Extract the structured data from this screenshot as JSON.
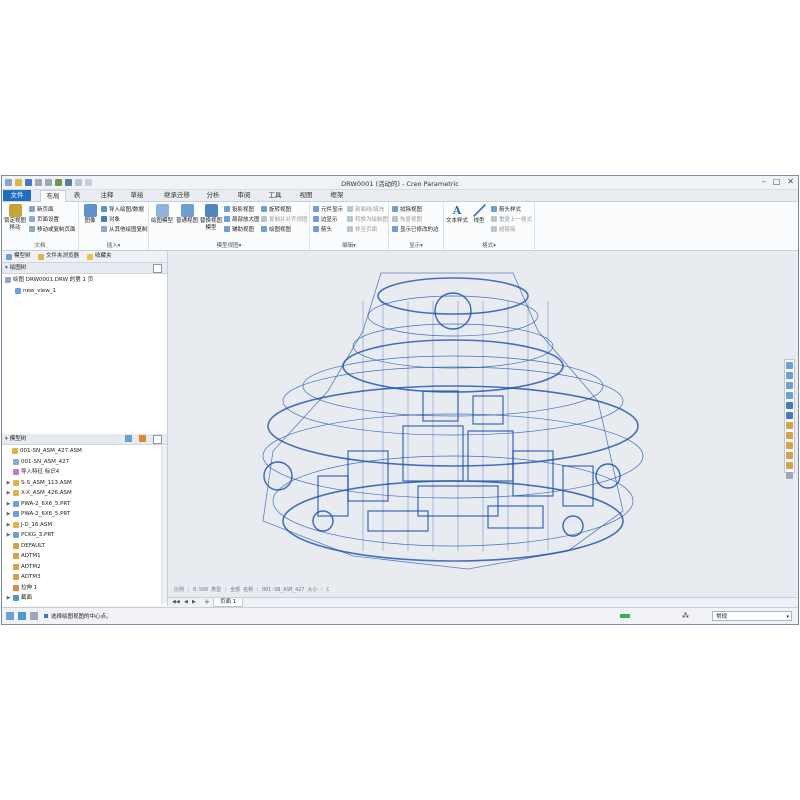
{
  "window": {
    "title": "DRW0001 (活动的) - Creo Parametric",
    "controls": {
      "minimize": "–",
      "maximize": "□",
      "close": "✕"
    }
  },
  "ribbon_tabs": [
    "文件",
    "布局",
    "表",
    "注释",
    "草绘",
    "继承迁移",
    "分析",
    "审阅",
    "工具",
    "视图",
    "框架"
  ],
  "ribbon": {
    "doc": {
      "label": "文档",
      "lock_view": "锁定视图\n移动",
      "new_page": "新页面",
      "page_setup": "页面设置",
      "move_copy_page": "移动或复制页面"
    },
    "insert": {
      "label": "插入▾",
      "image": "图像",
      "import_drawing": "导入绘图/数据",
      "object": "对象",
      "from_template": "从其他绘图复制"
    },
    "model_views": {
      "label": "模型视图▾",
      "drawing_model": "绘图模型",
      "normal_view": "普通视图",
      "replace_view": "替换视图\n模型",
      "projection_view": "投影视图",
      "detail_view": "局部放大图",
      "auxiliary_view": "辅助视图",
      "rotate_view": "旋转视图",
      "copy_align_view": "复制并对齐视图",
      "drawing_view": "绘图视图"
    },
    "edit": {
      "label": "编辑▾",
      "element_display": "元件显示",
      "edge_display": "边显示",
      "arrow": "箭头",
      "hatch_fill": "剖面线/填充",
      "convert_draft": "转换为绘制图",
      "move_to_page": "移至页面"
    },
    "display": {
      "label": "显示▾",
      "redraw": "拭除视图",
      "restore_view": "恢复视图",
      "show_modified": "显示已修改的边"
    },
    "format": {
      "label": "格式▾",
      "text_style": "文本样式",
      "line_style": "线型",
      "arrow_style": "箭头样式",
      "repeat_last": "重复上一格式",
      "hyperlink": "超链接"
    }
  },
  "left_panel": {
    "tabs": [
      "模型树",
      "文件夹浏览器",
      "收藏夹"
    ],
    "drawing_tree_title": "绘图树",
    "drawing_tree": [
      "绘图 DRW0001.DRW 的第 1 页",
      "new_view_1"
    ],
    "model_tree_title": "模型树",
    "model_tree": [
      {
        "label": "001-SN_ASM_427.ASM",
        "expand": "",
        "icon": "assembly-icon"
      },
      {
        "label": "001-SN_ASM_427",
        "expand": "",
        "icon": "datum-csys-icon"
      },
      {
        "label": "导入特征 标识4",
        "expand": "",
        "icon": "import-feature-icon"
      },
      {
        "label": "S-S_ASM_113.ASM",
        "expand": "▶",
        "icon": "assembly-icon"
      },
      {
        "label": "X-X_ASM_426.ASM",
        "expand": "▶",
        "icon": "assembly-icon"
      },
      {
        "label": "PWA-2_6X6_5.PRT",
        "expand": "▶",
        "icon": "part-icon"
      },
      {
        "label": "PWA-2_6X6_5.PRT",
        "expand": "▶",
        "icon": "part-icon"
      },
      {
        "label": "J-D_16.ASM",
        "expand": "▶",
        "icon": "assembly-icon"
      },
      {
        "label": "PCKG_3.PRT",
        "expand": "▶",
        "icon": "part-icon"
      },
      {
        "label": "DEFAULT",
        "expand": "",
        "icon": "csys-icon"
      },
      {
        "label": "ADTM1",
        "expand": "",
        "icon": "datum-plane-icon"
      },
      {
        "label": "ADTM2",
        "expand": "",
        "icon": "datum-plane-icon"
      },
      {
        "label": "ADTM3",
        "expand": "",
        "icon": "datum-plane-icon"
      },
      {
        "label": "拉伸 1",
        "expand": "",
        "icon": "extrude-icon"
      },
      {
        "label": "截面",
        "expand": "▶",
        "icon": "section-icon"
      }
    ]
  },
  "canvas": {
    "scale_text": "比例 : 0.500   类型 : 全部   名称 : 001-SN_ASM_427   大小 : C"
  },
  "sheet_bar": {
    "page_tab": "页面 1",
    "add": "+"
  },
  "status_bar": {
    "message": "选择绘图视图的中心点。",
    "filter_value": "常规"
  },
  "colors": {
    "accent": "#1d6ec0",
    "wireframe": "#1b4fb0",
    "canvas_bg": "#e8ecf1"
  }
}
